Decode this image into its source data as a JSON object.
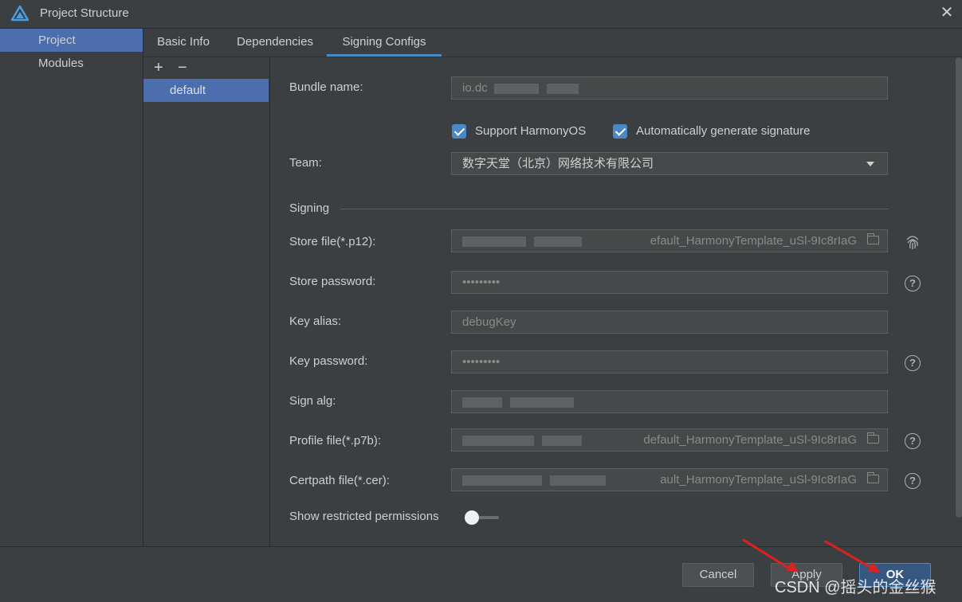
{
  "window": {
    "title": "Project Structure",
    "close_glyph": "✕"
  },
  "sidebar": {
    "items": [
      {
        "label": "Project",
        "selected": true
      },
      {
        "label": "Modules",
        "selected": false
      }
    ]
  },
  "tabs": [
    {
      "label": "Basic Info"
    },
    {
      "label": "Dependencies"
    },
    {
      "label": "Signing Configs",
      "selected": true
    }
  ],
  "config_list": {
    "add_glyph": "+",
    "remove_glyph": "−",
    "items": [
      "default"
    ]
  },
  "form": {
    "bundle_name_label": "Bundle name:",
    "bundle_name_value": "io.dc",
    "support_harmonyos_label": "Support HarmonyOS",
    "auto_sign_label": "Automatically generate signature",
    "team_label": "Team:",
    "team_value": "数字天堂（北京）网络技术有限公司",
    "signing_section": "Signing",
    "store_file_label": "Store file(*.p12):",
    "store_file_value": "efault_HarmonyTemplate_uSl-9Ic8rIaG",
    "store_password_label": "Store password:",
    "store_password_value": "•••••••••",
    "key_alias_label": "Key alias:",
    "key_alias_value": "debugKey",
    "key_password_label": "Key password:",
    "key_password_value": "•••••••••",
    "sign_alg_label": "Sign alg:",
    "profile_file_label": "Profile file(*.p7b):",
    "profile_file_value": "default_HarmonyTemplate_uSl-9Ic8rIaG",
    "certpath_file_label": "Certpath file(*.cer):",
    "certpath_file_value": "ault_HarmonyTemplate_uSl-9Ic8rIaG",
    "restricted_permissions_label": "Show restricted permissions",
    "help_glyph": "?"
  },
  "buttons": {
    "cancel": "Cancel",
    "apply": "Apply",
    "ok": "OK"
  },
  "watermark": "CSDN @摇头的金丝猴",
  "colors": {
    "accent": "#4a88c7",
    "selection": "#4b6eaf",
    "arrow": "#e02020",
    "background": "#3c3f41"
  }
}
